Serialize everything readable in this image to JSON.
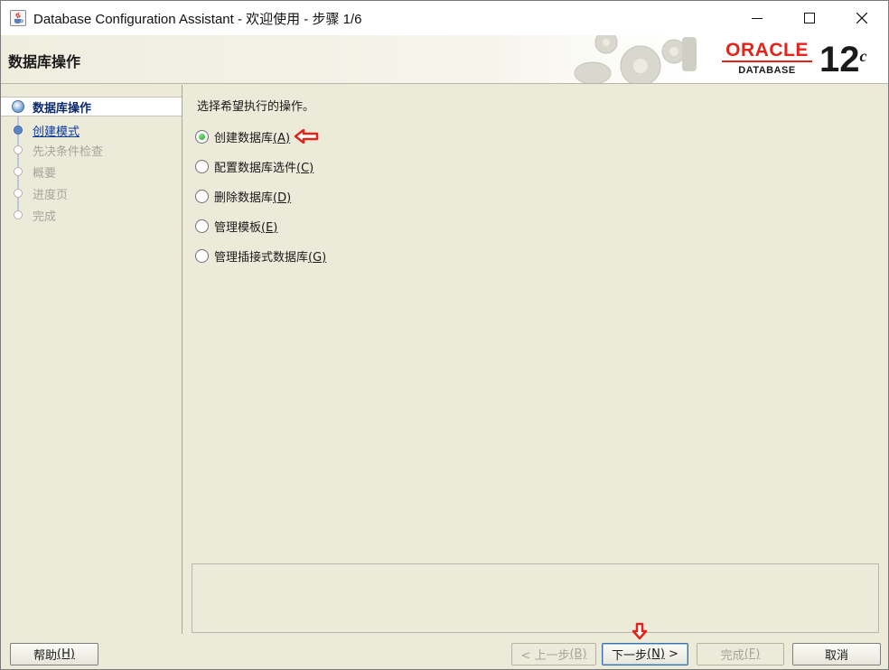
{
  "window": {
    "title": "Database Configuration Assistant - 欢迎使用 - 步骤 1/6",
    "app_icon": "java-cup-icon"
  },
  "banner": {
    "page_title": "数据库操作",
    "oracle_word": "ORACLE",
    "oracle_sub": "DATABASE",
    "version_main": "12",
    "version_sup": "c"
  },
  "steps": [
    {
      "label": "数据库操作",
      "state": "current"
    },
    {
      "label": "创建模式",
      "state": "link"
    },
    {
      "label": "先决条件检查",
      "state": "disabled"
    },
    {
      "label": "概要",
      "state": "disabled"
    },
    {
      "label": "进度页",
      "state": "disabled"
    },
    {
      "label": "完成",
      "state": "disabled"
    }
  ],
  "main": {
    "prompt": "选择希望执行的操作。",
    "options": [
      {
        "label": "创建数据库",
        "mnemonic": "(A)",
        "selected": true
      },
      {
        "label": "配置数据库选件",
        "mnemonic": "(C)",
        "selected": false
      },
      {
        "label": "删除数据库",
        "mnemonic": "(D)",
        "selected": false
      },
      {
        "label": "管理模板",
        "mnemonic": "(E)",
        "selected": false
      },
      {
        "label": "管理插接式数据库",
        "mnemonic": "(G)",
        "selected": false
      }
    ]
  },
  "buttons": {
    "help": {
      "text": "帮助",
      "mnemonic": "(H)"
    },
    "back": {
      "pre": "< 上一步",
      "mnemonic": "(B)",
      "post": ""
    },
    "next": {
      "pre": "下一步",
      "mnemonic": "(N)",
      "post": " >"
    },
    "finish": {
      "text": "完成",
      "mnemonic": "(F)"
    },
    "cancel": {
      "text": "取消"
    }
  },
  "colors": {
    "accent_red": "#e2231a",
    "step_current_text": "#0b2a6e",
    "step_link_text": "#0b3aa0",
    "disabled_text": "#a7a59a"
  }
}
